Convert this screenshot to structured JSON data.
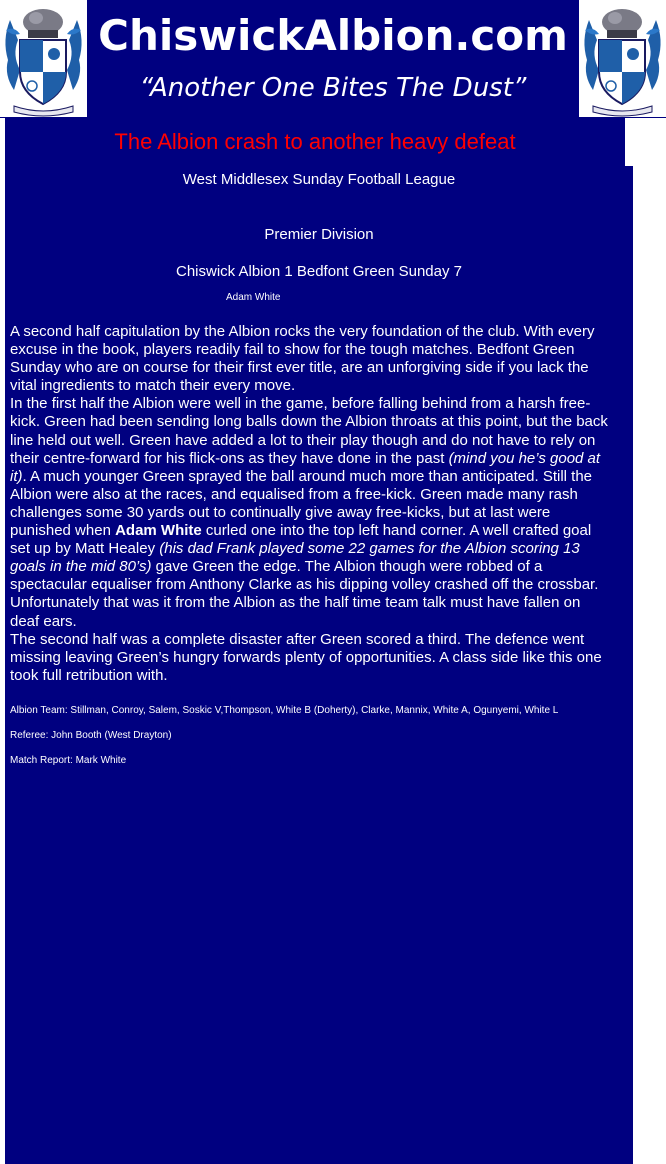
{
  "site": {
    "title": "ChiswickAlbion.com",
    "tagline": "“Another One Bites The Dust”"
  },
  "colors": {
    "panel": "#000080",
    "headline": "#ff0000",
    "text": "#ffffff"
  },
  "article": {
    "headline": "The Albion crash to another heavy defeat",
    "league": "West Middlesex Sunday Football League",
    "division": "Premier Division",
    "score_line": "Chiswick Albion 1 Bedfont Green Sunday 7",
    "author": "Adam White",
    "paragraphs": {
      "p1": "A second half capitulation by the Albion rocks the very foundation of the club. With every excuse in the book, players readily fail to show for the tough matches. Bedfont Green Sunday who are on course for their first ever title, are an unforgiving side if you lack the vital ingredients to match their every move.",
      "p2": {
        "a": "In the first half the Albion were well in the game, before falling behind from a harsh free-kick. Green had been sending long balls down the Albion throats at this point, but the back line held out well. Green have added a lot to their play though and do not have to rely on their centre-forward for his flick-ons as they have done in the past ",
        "aside1": "(mind you he’s good at it)",
        "b": ". A much younger Green sprayed the ball around much more than anticipated. Still the Albion were also at the races, and equalised from a free-kick. Green made many rash challenges some 30 yards out to continually give away free-kicks, but at last were punished when ",
        "scorer": "Adam White",
        "c": " curled one into the top left hand corner. A well crafted goal set up by Matt Healey ",
        "aside2": "(his dad Frank played some 22 games for the Albion scoring 13 goals in the mid 80’s)",
        "d": " gave Green the edge. The Albion though were robbed of a spectacular equaliser from Anthony Clarke as his dipping volley crashed off the crossbar. Unfortunately that was it from the Albion as the half time team talk must have fallen on deaf ears."
      },
      "p3": "The second half was a complete disaster after Green scored a third. The defence went missing leaving Green’s hungry forwards plenty of opportunities. A class side like this one took full retribution with."
    },
    "team": "Albion Team: Stillman, Conroy, Salem, Soskic V,Thompson, White B (Doherty), Clarke, Mannix, White A, Ogunyemi, White L",
    "referee": "Referee:  John Booth (West Drayton)",
    "match_report": "Match Report: Mark White"
  },
  "icons": {
    "crest_left": "club-crest-icon",
    "crest_right": "club-crest-icon"
  }
}
